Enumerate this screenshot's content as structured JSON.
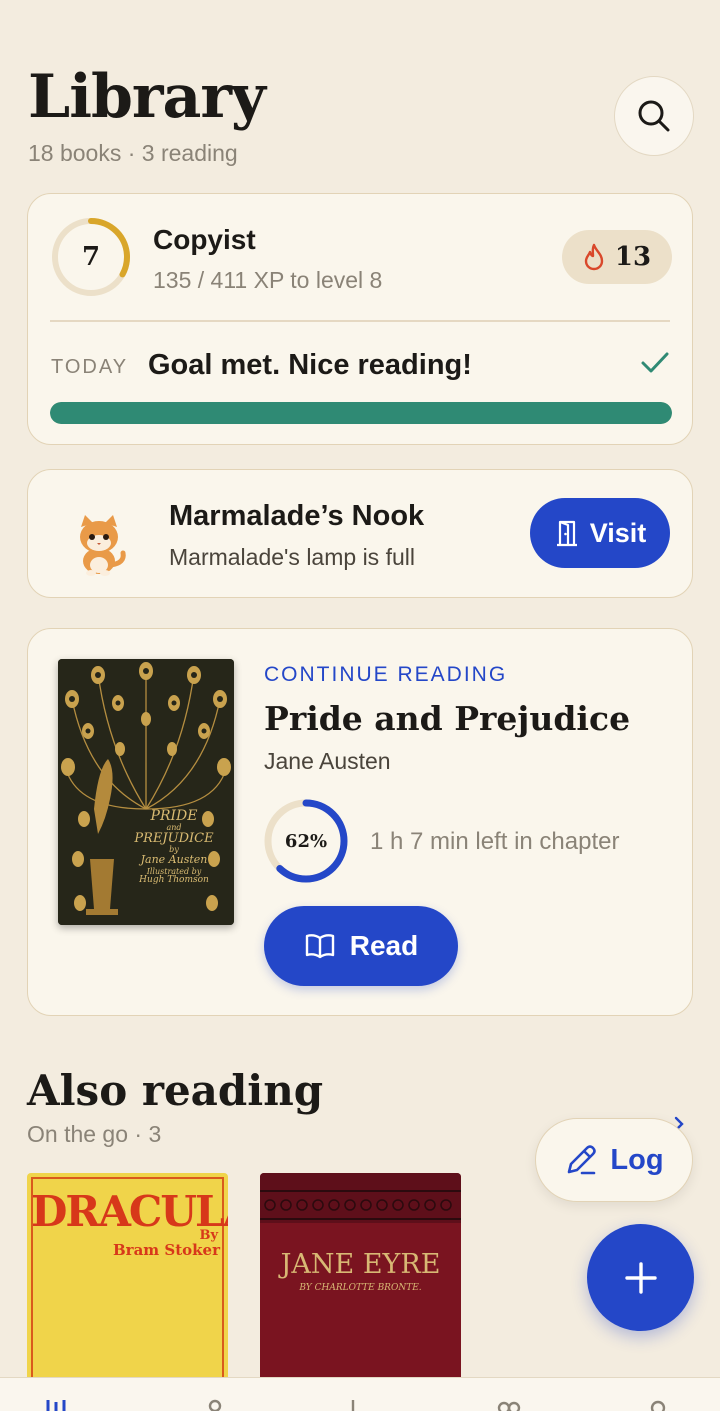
{
  "header": {
    "title": "Library",
    "subtitle": "18 books · 3 reading"
  },
  "progress_card": {
    "level": "7",
    "level_progress": 0.33,
    "rank": "Copyist",
    "xp_text": "135 / 411 XP to level 8",
    "streak": "13",
    "today_label": "TODAY",
    "today_message": "Goal met. Nice reading!",
    "goal_progress": 1.0
  },
  "nook": {
    "title": "Marmalade’s Nook",
    "subtitle": "Marmalade's lamp is full",
    "button_label": "Visit"
  },
  "continue_reading": {
    "label": "CONTINUE READING",
    "title": "Pride and Prejudice",
    "author": "Jane Austen",
    "progress_label": "62%",
    "progress": 0.62,
    "time_left": "1 h 7 min left in chapter",
    "button_label": "Read",
    "cover_text": {
      "line1": "PRIDE",
      "line2": "and",
      "line3": "PREJUDICE",
      "line4": "by",
      "line5": "Jane Austen",
      "line6": "Illustrated by",
      "line7": "Hugh Thomson"
    }
  },
  "also_reading": {
    "title": "Also reading",
    "subtitle": "On the go · 3",
    "books": [
      {
        "cover_title": "DRACULA",
        "cover_by": "By",
        "cover_author": "Bram Stoker"
      },
      {
        "cover_title": "JANE EYRE",
        "cover_author": "BY CHARLOTTE BRONTE."
      }
    ]
  },
  "actions": {
    "log_label": "Log"
  },
  "colors": {
    "accent": "#2447c8",
    "goal": "#2f8a74",
    "level_ring": "#d9a62a",
    "background": "#f3ecdf"
  }
}
